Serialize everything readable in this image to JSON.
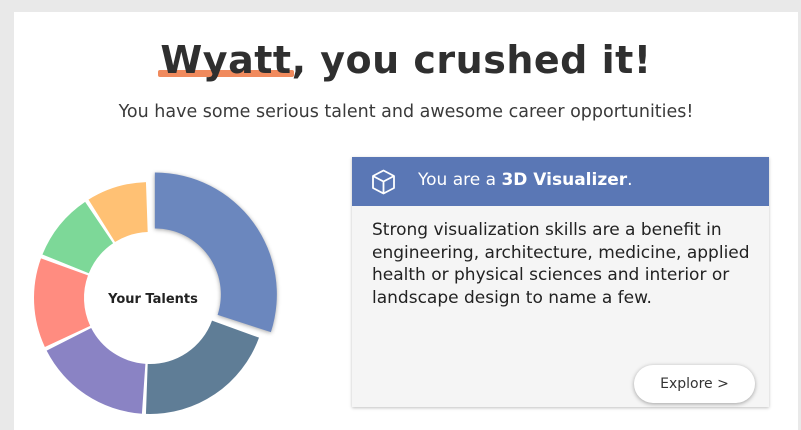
{
  "headline": {
    "name": "Wyatt",
    "rest": ", you crushed it!"
  },
  "subtitle": "You have some serious talent and awesome career opportunities!",
  "donut": {
    "center_label": "Your Talents",
    "segments": [
      {
        "name": "3D Visualizer",
        "color": "#6b87be",
        "selected": true
      },
      {
        "name": "",
        "color": "#5f7d96",
        "selected": false
      },
      {
        "name": "",
        "color": "#8a83c4",
        "selected": false
      },
      {
        "name": "",
        "color": "#ff8c80",
        "selected": false
      },
      {
        "name": "",
        "color": "#7dd898",
        "selected": false
      },
      {
        "name": "",
        "color": "#ffc174",
        "selected": false
      }
    ]
  },
  "talent": {
    "prefix": "You are a ",
    "name": "3D Visualizer",
    "suffix": ".",
    "icon": "cube-icon",
    "description": "Strong visualization skills are a benefit in engineering, architecture, medicine, applied health or physical sciences and interior or landscape design to name a few.",
    "button_label": "Explore >"
  },
  "colors": {
    "accent_underline": "#f08a5d",
    "header_bg": "#5a77b5"
  }
}
